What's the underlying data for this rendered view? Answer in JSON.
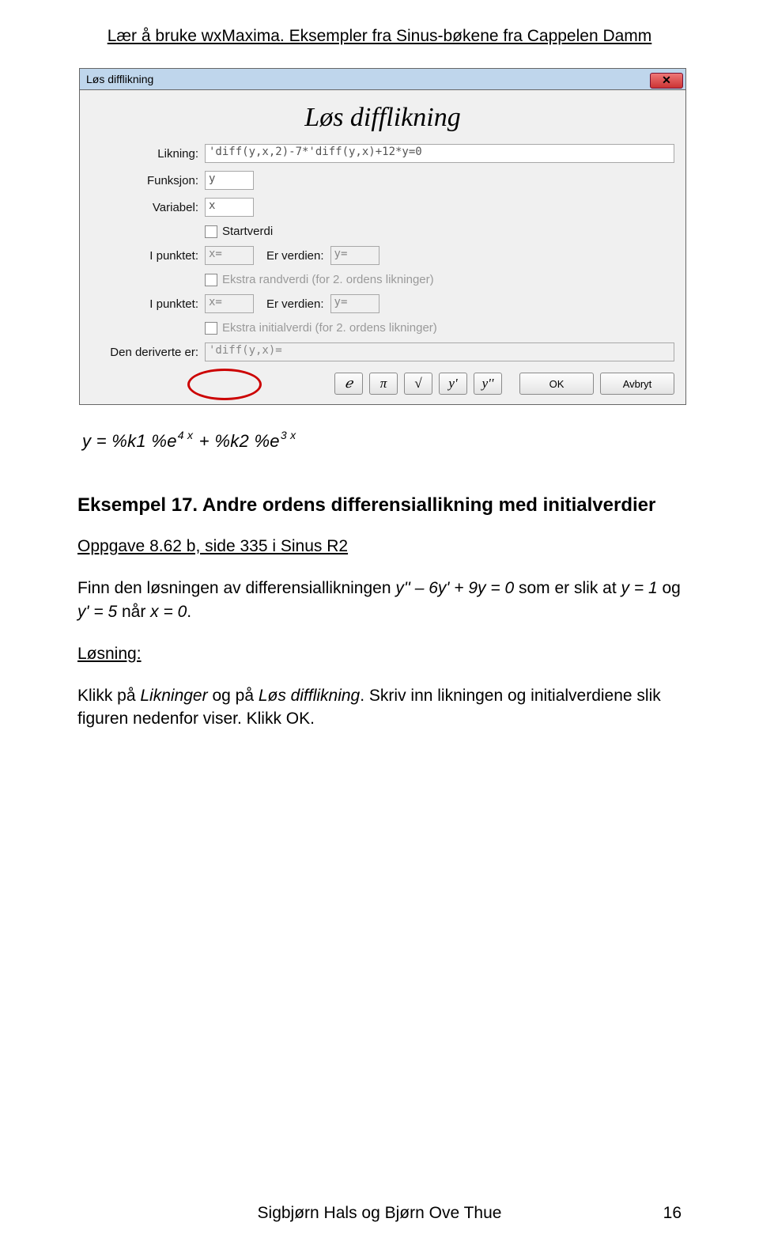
{
  "header": "Lær å bruke wxMaxima. Eksempler fra Sinus-bøkene fra Cappelen Damm",
  "dialog": {
    "title_bar": "Løs difflikning",
    "heading": "Løs difflikning",
    "labels": {
      "likning": "Likning:",
      "funksjon": "Funksjon:",
      "variabel": "Variabel:",
      "ipunktet": "I punktet:",
      "erverdien": "Er verdien:",
      "deriverte": "Den deriverte er:"
    },
    "values": {
      "likning": "'diff(y,x,2)-7*'diff(y,x)+12*y=0",
      "funksjon": "y",
      "variabel": "x",
      "ip1_x": "x=",
      "ip1_y": "y=",
      "ip2_x": "x=",
      "ip2_y": "y=",
      "deriverte": "'diff(y,x)="
    },
    "checks": {
      "start": "Startverdi",
      "rand": "Ekstra randverdi (for 2. ordens likninger)",
      "init": "Ekstra initialverdi (for 2. ordens likninger)"
    },
    "buttons": {
      "e": "ℯ",
      "pi": "π",
      "sqrt": "√",
      "yp": "y'",
      "ypp": "y''",
      "ok": "OK",
      "cancel": "Avbryt"
    },
    "close": "✕"
  },
  "equation_plain": "y = %k1 %e^(4 x) + %k2 %e^(3 x)",
  "eq": {
    "p1": "y = %k1 %e",
    "s1": "4 x",
    "p2": " + %k2 %e",
    "s2": "3 x"
  },
  "example_title": "Eksempel 17. Andre ordens differensiallikning med initialverdier",
  "task_ref": "Oppgave 8.62 b, side 335 i Sinus R2",
  "task": {
    "pre": "Finn den løsningen av differensiallikningen ",
    "eq": "y'' – 6y' + 9y = 0",
    "mid1": " som er slik at ",
    "c1": "y = 1",
    "mid2": " og ",
    "c2": "y' = 5",
    "mid3": " når ",
    "c3": "x = 0",
    "end": "."
  },
  "solution_label": "Løsning:",
  "solution": {
    "pre": "Klikk på ",
    "a": "Likninger",
    "mid": " og på ",
    "b": "Løs difflikning",
    "post": ". Skriv inn likningen og initialverdiene slik figuren nedenfor viser. Klikk OK."
  },
  "footer": "Sigbjørn Hals og Bjørn Ove Thue",
  "page_number": "16"
}
